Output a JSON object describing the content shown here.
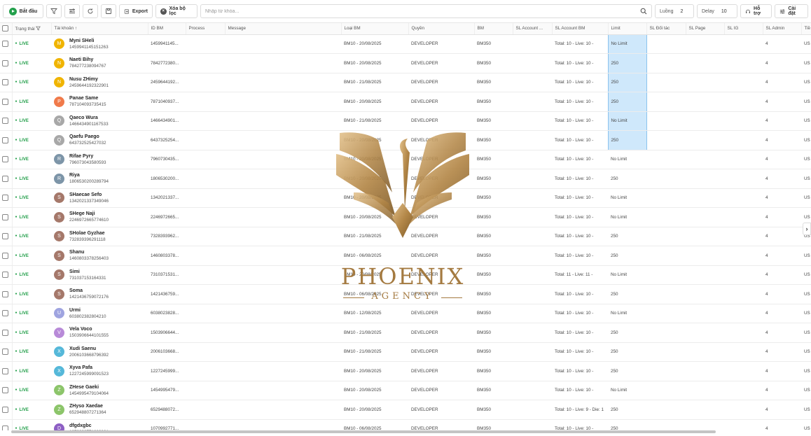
{
  "toolbar": {
    "start_label": "Bắt đầu",
    "export_label": "Export",
    "clear_filter_label": "Xóa bộ lọc",
    "search_placeholder": "Nhập từ khóa...",
    "threads_label": "Luồng",
    "threads_value": "2",
    "delay_label": "Delay",
    "delay_value": "10",
    "support_label": "Hỗ trợ",
    "settings_label": "Cài đặt"
  },
  "columns": [
    "Trạng thái",
    "Tài khoản",
    "ID BM",
    "Process",
    "Message",
    "Loại BM",
    "Quyền",
    "BM",
    "SL Account ...",
    "SL Account BM",
    "Limit",
    "SL Đối tác",
    "SL Page",
    "SL IG",
    "SL Admin",
    "Tiề"
  ],
  "rows": [
    {
      "status": "LIVE",
      "initial": "M",
      "color": "#f0b400",
      "name": "Myni SHeli",
      "id": "1459941145151263",
      "bm_id": "1459941145...",
      "bm_type": "BM10 - 20/08/2025",
      "role": "DEVELOPER",
      "bm": "BM350",
      "sl_bm": "Total: 10 - Live: 10 -",
      "limit": "No Limit",
      "admin": "4",
      "currency": "US"
    },
    {
      "status": "LIVE",
      "initial": "N",
      "color": "#f0b400",
      "name": "Naeti Bihy",
      "id": "784277238094767",
      "bm_id": "7842772380...",
      "bm_type": "BM10 - 20/08/2025",
      "role": "DEVELOPER",
      "bm": "BM350",
      "sl_bm": "Total: 10 - Live: 10 -",
      "limit": "250",
      "admin": "4",
      "currency": "US"
    },
    {
      "status": "LIVE",
      "initial": "N",
      "color": "#f0b400",
      "name": "Nusu ZHimy",
      "id": "2459644192322901",
      "bm_id": "2459644192...",
      "bm_type": "BM10 - 21/08/2025",
      "role": "DEVELOPER",
      "bm": "BM350",
      "sl_bm": "Total: 10 - Live: 10 -",
      "limit": "250",
      "admin": "4",
      "currency": "US"
    },
    {
      "status": "LIVE",
      "initial": "P",
      "color": "#f07a4a",
      "name": "Panae Same",
      "id": "787104093735415",
      "bm_id": "7871040937...",
      "bm_type": "BM10 - 20/08/2025",
      "role": "DEVELOPER",
      "bm": "BM350",
      "sl_bm": "Total: 10 - Live: 10 -",
      "limit": "250",
      "admin": "4",
      "currency": "US"
    },
    {
      "status": "LIVE",
      "initial": "Q",
      "color": "#a8a8a8",
      "name": "Qaeco Wura",
      "id": "1466434901167533",
      "bm_id": "1466434901...",
      "bm_type": "BM10 - 21/08/2025",
      "role": "DEVELOPER",
      "bm": "BM350",
      "sl_bm": "Total: 10 - Live: 10 -",
      "limit": "No Limit",
      "admin": "4",
      "currency": "US"
    },
    {
      "status": "LIVE",
      "initial": "Q",
      "color": "#a8a8a8",
      "name": "Qaefu Paego",
      "id": "643732525427032",
      "bm_id": "6437325254...",
      "bm_type": "BM10 - 20/08/2025",
      "role": "DEVELOPER",
      "bm": "BM350",
      "sl_bm": "Total: 10 - Live: 10 -",
      "limit": "250",
      "admin": "4",
      "currency": "US"
    },
    {
      "status": "LIVE",
      "initial": "R",
      "color": "#7d95a8",
      "name": "Rifae Pyry",
      "id": "796073043580593",
      "bm_id": "7960730435...",
      "bm_type": "BM10 - 20/08/2025",
      "role": "DEVELOPER",
      "bm": "BM350",
      "sl_bm": "Total: 10 - Live: 10 -",
      "limit": "No Limit",
      "admin": "4",
      "currency": "US"
    },
    {
      "status": "LIVE",
      "initial": "R",
      "color": "#7d95a8",
      "name": "Riya",
      "id": "1806530200289794",
      "bm_id": "1806530200...",
      "bm_type": "BM10 - 20/08/2025",
      "role": "DEVELOPER",
      "bm": "BM350",
      "sl_bm": "Total: 10 - Live: 10 -",
      "limit": "250",
      "admin": "4",
      "currency": "US"
    },
    {
      "status": "LIVE",
      "initial": "S",
      "color": "#a5786a",
      "name": "SHaecae Sefo",
      "id": "1342021337349046",
      "bm_id": "1342021337...",
      "bm_type": "BM10 - 20/08/2025",
      "role": "DEVELOPER",
      "bm": "BM350",
      "sl_bm": "Total: 10 - Live: 10 -",
      "limit": "No Limit",
      "admin": "4",
      "currency": "US"
    },
    {
      "status": "LIVE",
      "initial": "S",
      "color": "#a5786a",
      "name": "SHege Naji",
      "id": "2246972665774610",
      "bm_id": "2246972665...",
      "bm_type": "BM10 - 20/08/2025",
      "role": "DEVELOPER",
      "bm": "BM350",
      "sl_bm": "Total: 10 - Live: 10 -",
      "limit": "No Limit",
      "admin": "4",
      "currency": "US"
    },
    {
      "status": "LIVE",
      "initial": "S",
      "color": "#a5786a",
      "name": "SHolae Gyzhae",
      "id": "732839396291118",
      "bm_id": "7328393962...",
      "bm_type": "BM10 - 21/08/2025",
      "role": "DEVELOPER",
      "bm": "BM350",
      "sl_bm": "Total: 10 - Live: 10 -",
      "limit": "250",
      "admin": "4",
      "currency": "US"
    },
    {
      "status": "LIVE",
      "initial": "S",
      "color": "#a5786a",
      "name": "Shanu",
      "id": "1460803378256403",
      "bm_id": "1460803378...",
      "bm_type": "BM10 - 06/08/2025",
      "role": "DEVELOPER",
      "bm": "BM350",
      "sl_bm": "Total: 10 - Live: 10 -",
      "limit": "250",
      "admin": "4",
      "currency": "US"
    },
    {
      "status": "LIVE",
      "initial": "S",
      "color": "#a5786a",
      "name": "Simi",
      "id": "731037153164331",
      "bm_id": "7310371531...",
      "bm_type": "BM10 - 20/08/2025",
      "role": "DEVELOPER",
      "bm": "BM350",
      "sl_bm": "Total: 11 - Live: 11 -",
      "limit": "No Limit",
      "admin": "4",
      "currency": "US"
    },
    {
      "status": "LIVE",
      "initial": "S",
      "color": "#a5786a",
      "name": "Soma",
      "id": "1421436759072176",
      "bm_id": "1421436759...",
      "bm_type": "BM10 - 06/08/2025",
      "role": "DEVELOPER",
      "bm": "BM350",
      "sl_bm": "Total: 10 - Live: 10 -",
      "limit": "250",
      "admin": "4",
      "currency": "US"
    },
    {
      "status": "LIVE",
      "initial": "U",
      "color": "#9fa4e0",
      "name": "Urmi",
      "id": "603802382804210",
      "bm_id": "6038023828...",
      "bm_type": "BM10 - 12/08/2025",
      "role": "DEVELOPER",
      "bm": "BM350",
      "sl_bm": "Total: 10 - Live: 10 -",
      "limit": "No Limit",
      "admin": "4",
      "currency": "US"
    },
    {
      "status": "LIVE",
      "initial": "V",
      "color": "#b88ad8",
      "name": "Vela Voco",
      "id": "1503906644101555",
      "bm_id": "1503906644...",
      "bm_type": "BM10 - 21/08/2025",
      "role": "DEVELOPER",
      "bm": "BM350",
      "sl_bm": "Total: 10 - Live: 10 -",
      "limit": "250",
      "admin": "4",
      "currency": "US"
    },
    {
      "status": "LIVE",
      "initial": "X",
      "color": "#55b8d9",
      "name": "Xudi Saenu",
      "id": "2006103668796392",
      "bm_id": "2006103668...",
      "bm_type": "BM10 - 21/08/2025",
      "role": "DEVELOPER",
      "bm": "BM350",
      "sl_bm": "Total: 10 - Live: 10 -",
      "limit": "250",
      "admin": "4",
      "currency": "US"
    },
    {
      "status": "LIVE",
      "initial": "X",
      "color": "#55b8d9",
      "name": "Xyva Pafa",
      "id": "1227245999091523",
      "bm_id": "1227245999...",
      "bm_type": "BM10 - 20/08/2025",
      "role": "DEVELOPER",
      "bm": "BM350",
      "sl_bm": "Total: 10 - Live: 10 -",
      "limit": "250",
      "admin": "4",
      "currency": "US"
    },
    {
      "status": "LIVE",
      "initial": "Z",
      "color": "#8cc56a",
      "name": "ZHese Gaeki",
      "id": "1454995479104064",
      "bm_id": "1454995479...",
      "bm_type": "BM10 - 20/08/2025",
      "role": "DEVELOPER",
      "bm": "BM350",
      "sl_bm": "Total: 10 - Live: 10 -",
      "limit": "No Limit",
      "admin": "4",
      "currency": "US"
    },
    {
      "status": "LIVE",
      "initial": "Z",
      "color": "#8cc56a",
      "name": "ZHyso Xaedae",
      "id": "652948807271364",
      "bm_id": "6529488072...",
      "bm_type": "BM10 - 20/08/2025",
      "role": "DEVELOPER",
      "bm": "BM350",
      "sl_bm": "Total: 10 - Live: 9 - Die: 1",
      "limit": "250",
      "admin": "4",
      "currency": "US"
    },
    {
      "status": "LIVE",
      "initial": "D",
      "color": "#8d5fc4",
      "name": "dfgdxgbc",
      "id": "1070992771829801",
      "bm_id": "1070992771...",
      "bm_type": "BM10 - 06/08/2025",
      "role": "DEVELOPER",
      "bm": "BM350",
      "sl_bm": "Total: 10 - Live: 10 -",
      "limit": "250",
      "admin": "4",
      "currency": "US"
    }
  ],
  "logo": {
    "name": "PHOENIX",
    "sub": "AGENCY",
    "color": "#a47a40"
  },
  "colors": {
    "live": "#1f9d47",
    "highlight": "#cfe8fb",
    "start": "#22a04b"
  }
}
